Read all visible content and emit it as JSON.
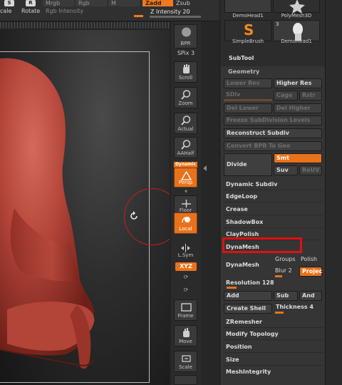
{
  "toolbar": {
    "scale_label": "cale",
    "rotate_label": "Rotate",
    "scale_glyph": "S",
    "rotate_glyph": "R",
    "mrgb": "Mrgb",
    "rgb": "Rgb",
    "m": "M",
    "zadd": "Zadd",
    "zsub": "Zsub",
    "rgb_intensity": "Rgb Intensity",
    "z_intensity": "Z Intensity 20"
  },
  "shelf": {
    "bpr": "BPR",
    "spix": "SPix 3",
    "scroll": "Scroll",
    "zoom": "Zoom",
    "actual": "Actual",
    "aahalf": "AAHalf",
    "dynamic": "Dynamic",
    "persp": "Persp",
    "floor": "Floor",
    "local": "Local",
    "lsym": "L.Sym",
    "xyz": "XYZ",
    "frame": "Frame",
    "move": "Move",
    "scale": "Scale"
  },
  "subtool_thumbs": [
    {
      "label": "DemoHead1"
    },
    {
      "label": "PolyMesh3D"
    },
    {
      "label": "SimpleBrush"
    },
    {
      "label": "DemoHead1",
      "badge": "3"
    }
  ],
  "palette": {
    "subtool_header": "SubTool",
    "geometry_header": "Geometry",
    "lower_res": "Lower Res",
    "higher_res": "Higher Res",
    "sdiv": "SDiv",
    "cage": "Cage",
    "rstr": "Rstr",
    "del_lower": "Del Lower",
    "del_higher": "Del Higher",
    "freeze": "Freeze SubDivision Levels",
    "reconstruct": "Reconstruct Subdiv",
    "convert_bpr": "Convert BPR To Geo",
    "divide": "Divide",
    "smt": "Smt",
    "suv": "Suv",
    "reuv": "ReUV",
    "dynamic_subdiv": "Dynamic Subdiv",
    "edgeloop": "EdgeLoop",
    "crease": "Crease",
    "shadowbox": "ShadowBox",
    "claypolish": "ClayPolish",
    "dynamesh_header": "DynaMesh",
    "dynamesh_btn": "DynaMesh",
    "groups": "Groups",
    "polish": "Polish",
    "blur": "Blur 2",
    "project": "Projec",
    "resolution": "Resolution 128",
    "add": "Add",
    "sub": "Sub",
    "and": "And",
    "create_shell": "Create Shell",
    "thickness": "Thickness 4",
    "zremesher": "ZRemesher",
    "modify_topology": "Modify Topology",
    "position": "Position",
    "size": "Size",
    "meshintegrity": "MeshIntegrity"
  },
  "colors": {
    "accent": "#e8721c",
    "highlight": "#e01010",
    "model": "#b4453a"
  }
}
